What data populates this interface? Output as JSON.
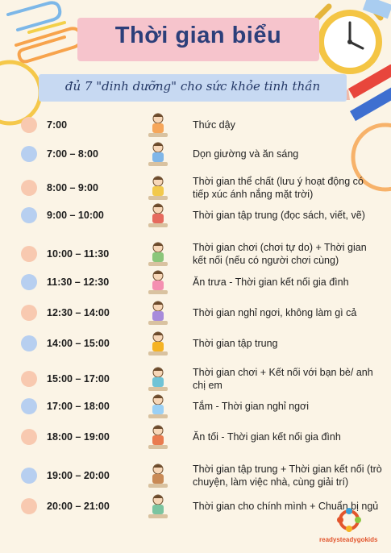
{
  "header": {
    "title": "Thời gian biểu",
    "subtitle": "đủ 7 \"dinh dưỡng\" cho sức khỏe tinh thần"
  },
  "colors": {
    "peach": "#f8c9b0",
    "blue": "#b7cff0",
    "title": "#2c3f7a"
  },
  "schedule": [
    {
      "time": "7:00",
      "activity": "Thức dậy",
      "dot": "peach",
      "icon": "wake-up-icon"
    },
    {
      "time": "7:00 – 8:00",
      "activity": "Dọn giường và ăn sáng",
      "dot": "blue",
      "icon": "breakfast-icon"
    },
    {
      "time": "8:00 – 9:00",
      "activity": "Thời gian thể chất (lưu ý hoạt động có tiếp xúc ánh nắng mặt trời)",
      "dot": "peach",
      "icon": "exercise-icon"
    },
    {
      "time": "9:00 – 10:00",
      "activity": "Thời gian tập trung (đọc sách, viết, vẽ)",
      "dot": "blue",
      "icon": "painting-icon"
    },
    {
      "time": "10:00 – 11:30",
      "activity": "Thời gian chơi (chơi tự do) + Thời gian kết nối (nếu có người chơi cùng)",
      "dot": "peach",
      "icon": "playing-icon"
    },
    {
      "time": "11:30 – 12:30",
      "activity": "Ăn trưa - Thời gian kết nối gia đình",
      "dot": "blue",
      "icon": "lunch-icon"
    },
    {
      "time": "12:30 – 14:00",
      "activity": "Thời gian nghỉ ngơi, không làm gì cả",
      "dot": "peach",
      "icon": "resting-icon"
    },
    {
      "time": "14:00 – 15:00",
      "activity": "Thời gian tập trung",
      "dot": "blue",
      "icon": "reading-icon"
    },
    {
      "time": "15:00 – 17:00",
      "activity": "Thời gian chơi + Kết nối với bạn bè/ anh chị em",
      "dot": "peach",
      "icon": "friends-icon"
    },
    {
      "time": "17:00 – 18:00",
      "activity": "Tắm - Thời gian nghỉ ngơi",
      "dot": "blue",
      "icon": "shower-icon"
    },
    {
      "time": "18:00 – 19:00",
      "activity": "Ăn tối - Thời gian kết nối gia đình",
      "dot": "peach",
      "icon": "dinner-icon"
    },
    {
      "time": "19:00 – 20:00",
      "activity": "Thời gian tập trung + Thời gian kết nối (trò chuyện, làm việc nhà, cùng giải trí)",
      "dot": "blue",
      "icon": "chores-icon"
    },
    {
      "time": "20:00 – 21:00",
      "activity": "Thời gian cho chính mình + Chuẩn bị ngủ",
      "dot": "peach",
      "icon": "meditation-icon"
    }
  ],
  "logo": {
    "text": "readysteadygokids"
  }
}
